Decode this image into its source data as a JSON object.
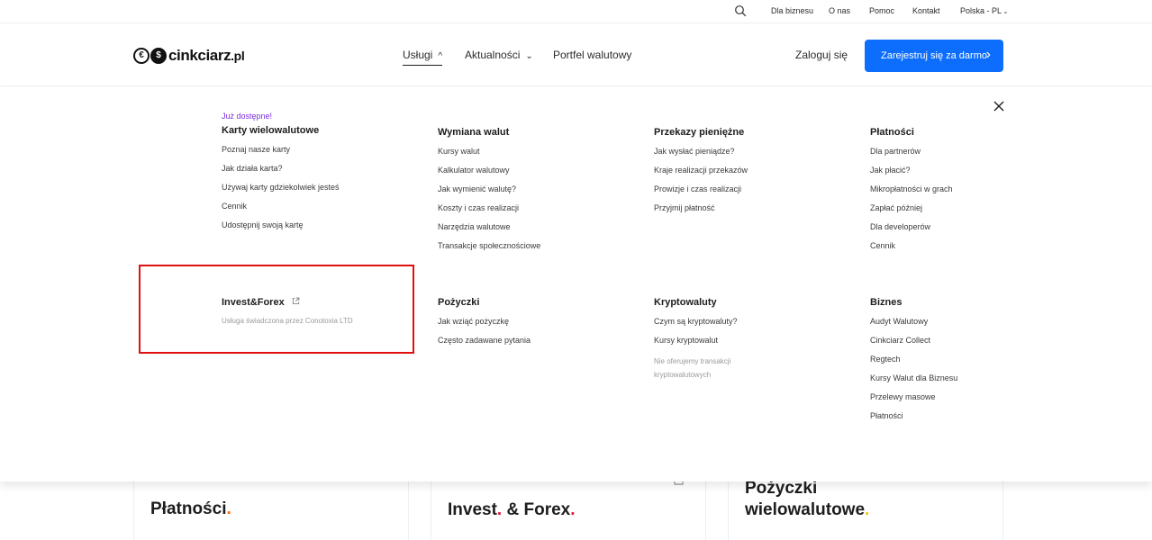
{
  "topbar": {
    "links": [
      "Dla biznesu",
      "O nas",
      "Pomoc",
      "Kontakt"
    ],
    "language": "Polska - PL",
    "icons": {
      "search": "search-icon",
      "language_caret": "chevron-down-icon"
    }
  },
  "header": {
    "logo_text": "cinkciarz",
    "logo_tld": ".pl",
    "logo_glyphs": [
      "€",
      "$"
    ],
    "nav": [
      {
        "label": "Usługi",
        "expanded": true
      },
      {
        "label": "Aktualności",
        "expanded": false
      },
      {
        "label": "Portfel walutowy",
        "expanded": false
      }
    ],
    "login": "Zaloguj się",
    "register": "Zarejestruj się za darmo",
    "colors": {
      "accent": "#0d6efd",
      "new_badge": "#7b2fe0"
    }
  },
  "menu": {
    "karty": {
      "badge": "Już dostępne!",
      "title": "Karty wielowalutowe",
      "items": [
        "Poznaj nasze karty",
        "Jak działa karta?",
        "Używaj karty gdziekolwiek jesteś",
        "Cennik",
        "Udostępnij swoją kartę"
      ]
    },
    "wymiana": {
      "title": "Wymiana walut",
      "items": [
        "Kursy walut",
        "Kalkulator walutowy",
        "Jak wymienić walutę?",
        "Koszty i czas realizacji",
        "Narzędzia walutowe",
        "Transakcje społecznościowe"
      ]
    },
    "przekazy": {
      "title": "Przekazy pieniężne",
      "items": [
        "Jak wysłać pieniądze?",
        "Kraje realizacji przekazów",
        "Prowizje i czas realizacji",
        "Przyjmij płatność"
      ]
    },
    "platnosci": {
      "title": "Płatności",
      "items": [
        "Dla partnerów",
        "Jak płacić?",
        "Mikropłatności w grach",
        "Zapłać później",
        "Dla developerów",
        "Cennik"
      ]
    },
    "invest": {
      "title": "Invest&Forex",
      "subtitle": "Usługa świadczona przez Conotoxia LTD"
    },
    "pozyczki": {
      "title": "Pożyczki",
      "items": [
        "Jak wziąć pożyczkę",
        "Często zadawane pytania"
      ]
    },
    "krypto": {
      "title": "Kryptowaluty",
      "items": [
        "Czym są kryptowaluty?",
        "Kursy kryptowalut"
      ],
      "note": "Nie oferujemy transakcji kryptowalutowych"
    },
    "biznes": {
      "title": "Biznes",
      "items": [
        "Audyt Walutowy",
        "Cinkciarz Collect",
        "Regtech",
        "Kursy Walut dla Biznesu",
        "Przelewy masowe",
        "Płatności"
      ]
    }
  },
  "cards": [
    {
      "lines": [
        "Płatności"
      ],
      "dot": "."
    },
    {
      "lines": [
        "Invest",
        "& Forex"
      ],
      "dot": "."
    },
    {
      "lines": [
        "Pożyczki",
        "wielowalutowe"
      ],
      "dot": "."
    }
  ]
}
